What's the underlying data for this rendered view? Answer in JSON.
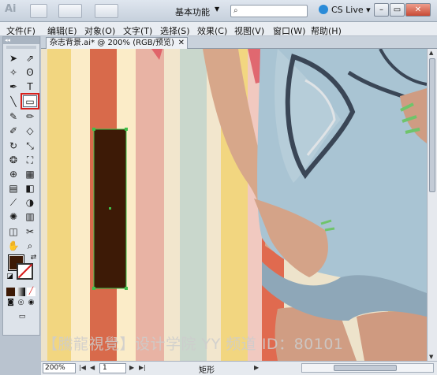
{
  "app": {
    "logo": "Ai"
  },
  "appbar": {
    "workspace": "基本功能",
    "search_placeholder": "",
    "cslive": "CS Live"
  },
  "menu": [
    "文件(F)",
    "编辑(E)",
    "对象(O)",
    "文字(T)",
    "选择(S)",
    "效果(C)",
    "视图(V)",
    "窗口(W)",
    "帮助(H)"
  ],
  "document": {
    "tab_title": "杂志背景.ai* @ 200% (RGB/预览)"
  },
  "tools_panel": {
    "collapse": "◂◂"
  },
  "watermark": "【騰龍視覺】设计学院  YY 频道 ID：80101",
  "status": {
    "zoom": "200%",
    "page": "1",
    "current_tool": "矩形"
  },
  "colors": {
    "fill": "#3d1a06",
    "highlight": "#d8201b",
    "stripes": [
      "#f2d680",
      "#fbecc8",
      "#d86a4b",
      "#fbecc8",
      "#e8b3a4",
      "#f2e6cd",
      "#c9d7cc",
      "#f2d680",
      "#f1c9c0",
      "#f0d36c"
    ]
  }
}
